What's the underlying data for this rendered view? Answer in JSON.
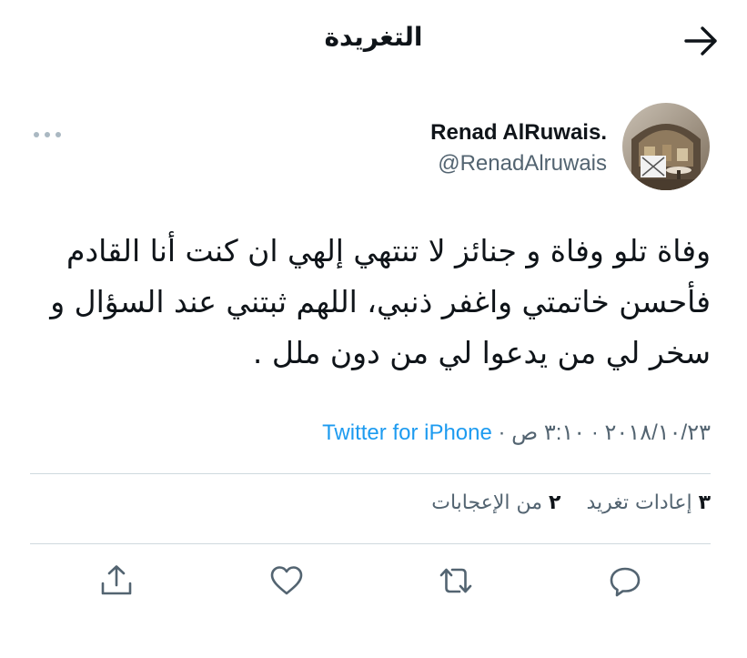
{
  "header": {
    "title": "التغريدة"
  },
  "author": {
    "display_name": "Renad AlRuwais.",
    "handle": "@RenadAlruwais"
  },
  "tweet": {
    "text": "وفاة تلو وفاة و جنائز لا تنتهي إلهي ان كنت أنا القادم فأحسن خاتمتي واغفر ذنبي، اللهم ثبتني عند السؤال و سخر لي من يدعوا لي من دون ملل ."
  },
  "meta": {
    "date": "٢٠١٨/١٠/٢٣",
    "sep1": " · ",
    "time": "٣:١٠ ص",
    "sep2": " · ",
    "source": "Twitter for iPhone"
  },
  "stats": {
    "retweets_count": "٣",
    "retweets_label": "إعادات تغريد",
    "likes_count": "٢",
    "likes_label": "من الإعجابات"
  },
  "icons": {
    "back": "arrow-right-icon",
    "more": "more-dots-icon",
    "reply": "reply-icon",
    "retweet": "retweet-icon",
    "like": "heart-icon",
    "share": "share-icon"
  },
  "colors": {
    "accent": "#1d9bf0",
    "secondary_text": "#536471",
    "divider": "#cfd9de"
  }
}
